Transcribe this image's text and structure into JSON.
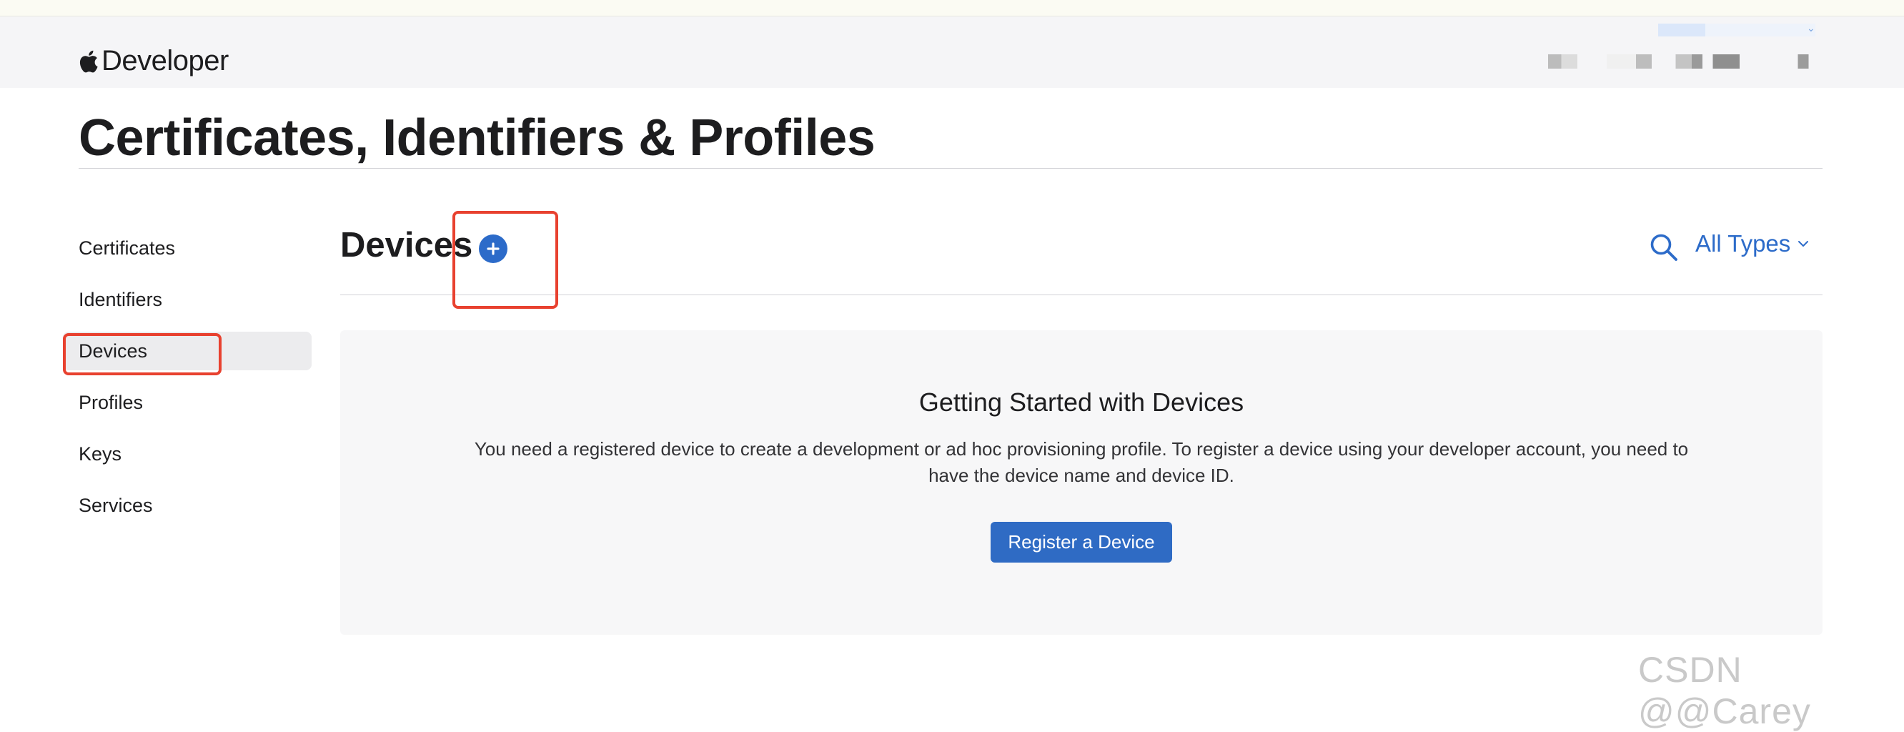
{
  "header": {
    "brand": "Developer",
    "account_name": "",
    "account_team": ""
  },
  "page_title": "Certificates, Identifiers & Profiles",
  "sidebar": {
    "items": [
      {
        "label": "Certificates"
      },
      {
        "label": "Identifiers"
      },
      {
        "label": "Devices",
        "active": true
      },
      {
        "label": "Profiles"
      },
      {
        "label": "Keys"
      },
      {
        "label": "Services"
      }
    ]
  },
  "main": {
    "section_title": "Devices",
    "add_icon": "plus-circle-icon",
    "search_icon": "search-icon",
    "filter_label": "All Types"
  },
  "empty_state": {
    "title": "Getting Started with Devices",
    "body": "You need a registered device to create a development or ad hoc provisioning profile. To register a device using your developer account, you need to have the device name and device ID.",
    "button_label": "Register a Device"
  },
  "watermark": "CSDN @@Carey",
  "colors": {
    "accent": "#2c6bc9",
    "highlight_box": "#e8412f",
    "header_bg": "#f5f5f7",
    "panel_bg": "#f7f7f8"
  }
}
